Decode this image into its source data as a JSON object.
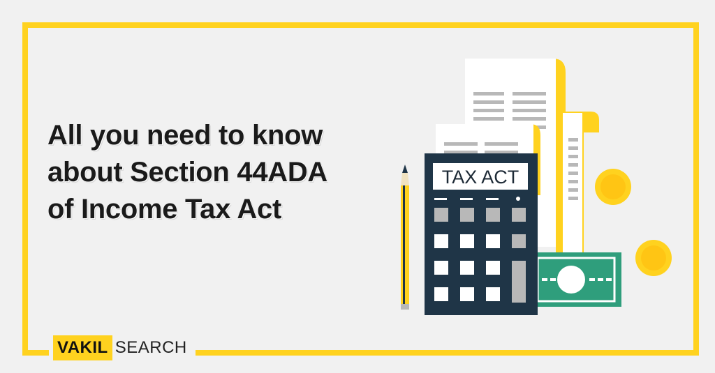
{
  "headline": {
    "line1": "All you need to know",
    "line2": "about Section 44ADA",
    "line3": "of Income Tax Act"
  },
  "brand": {
    "box_text": "VAKIL",
    "text": "SEARCH"
  },
  "illustration": {
    "calculator_label": "TAX ACT"
  },
  "colors": {
    "accent": "#ffd21f",
    "calculator": "#1f3547",
    "money": "#2f9e7c",
    "background": "#f1f1f1"
  },
  "icons": [
    "receipt-icon",
    "calculator-icon",
    "pencil-icon",
    "banknote-icon",
    "coin-icon"
  ]
}
